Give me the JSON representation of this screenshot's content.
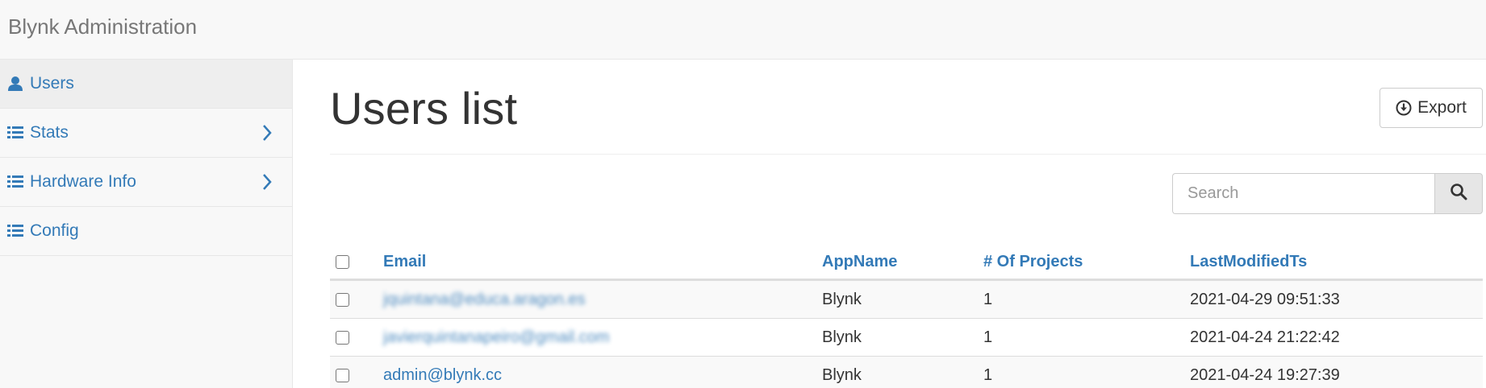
{
  "navbar": {
    "brand": "Blynk Administration"
  },
  "sidebar": {
    "items": [
      {
        "label": "Users",
        "icon": "user-icon",
        "active": true,
        "has_chevron": false
      },
      {
        "label": "Stats",
        "icon": "list-icon",
        "active": false,
        "has_chevron": true
      },
      {
        "label": "Hardware Info",
        "icon": "list-icon",
        "active": false,
        "has_chevron": true
      },
      {
        "label": "Config",
        "icon": "list-icon",
        "active": false,
        "has_chevron": false
      }
    ]
  },
  "main": {
    "title": "Users list",
    "export_label": "Export",
    "search": {
      "placeholder": "Search",
      "value": ""
    }
  },
  "table": {
    "columns": [
      "Email",
      "AppName",
      "# Of Projects",
      "LastModifiedTs"
    ],
    "rows": [
      {
        "email": "jquintana@educa.aragon.es",
        "email_blurred": true,
        "app": "Blynk",
        "projects": "1",
        "ts": "2021-04-29 09:51:33"
      },
      {
        "email": "javierquintanapeiro@gmail.com",
        "email_blurred": true,
        "app": "Blynk",
        "projects": "1",
        "ts": "2021-04-24 21:22:42"
      },
      {
        "email": "admin@blynk.cc",
        "email_blurred": false,
        "app": "Blynk",
        "projects": "1",
        "ts": "2021-04-24 19:27:39"
      }
    ]
  },
  "colors": {
    "link": "#337ab7",
    "text": "#333333",
    "muted": "#777777",
    "border": "#dddddd"
  }
}
